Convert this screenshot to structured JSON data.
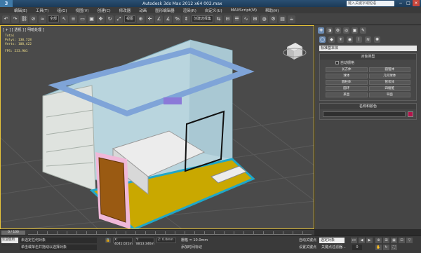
{
  "window": {
    "logo": "3",
    "title": "Autodesk 3ds Max  2012 x64     002.max",
    "search_placeholder": "键入关键字或短语",
    "buttons": [
      "−",
      "□",
      "×"
    ]
  },
  "menu": [
    "编辑(E)",
    "工具(T)",
    "组(G)",
    "视图(V)",
    "创建(C)",
    "修改器",
    "动画",
    "图形编辑器",
    "渲染(R)",
    "自定义(U)",
    "MAXScript(M)",
    "帮助(H)"
  ],
  "toolbar": {
    "filter_dropdown": "全部",
    "view_dropdown": "视图",
    "selection_set": "创建选择集"
  },
  "viewport": {
    "label": "[ + ] [ 透视 ] [ 明暗处理 ]",
    "stats": {
      "total_label": "Total",
      "polys": "Polys:  130,728",
      "verts": "Verts:  108,422",
      "fps": "FPS:    233.901"
    }
  },
  "panel": {
    "tabs": [
      "✚",
      "◑",
      "⚙",
      "◎",
      "▣",
      "✎"
    ],
    "subtabs": [
      "◯",
      "◆",
      "☀",
      "◉",
      "⌇",
      "≋",
      "✺"
    ],
    "category_dropdown": "标准基本体",
    "object_type_title": "对象类型",
    "autogrid": "自动栅格",
    "objects": [
      "长方体",
      "圆锥体",
      "球体",
      "几何球体",
      "圆柱体",
      "管状体",
      "圆环",
      "四棱锥",
      "茶壶",
      "平面"
    ],
    "name_color_title": "名称和颜色",
    "accent_color": "#b5124a"
  },
  "timeline": {
    "slider": "0 / 100"
  },
  "status": {
    "welcome": "欢迎使用 MAXSc",
    "msg1": "未选定任何对象",
    "msg2": "单击或单击并拖动以选择对象",
    "x": "X: 4041.021m",
    "y": "Y: 8813.346m",
    "z": "Z: 0.0mm",
    "grid": "栅格 = 10.0mm",
    "add_tag": "添加时间标记",
    "autokey": "自动关键点",
    "selection": "选定对象",
    "setkey": "设置关键点",
    "keyfilter": "关键点过滤器...",
    "frame": "0"
  }
}
